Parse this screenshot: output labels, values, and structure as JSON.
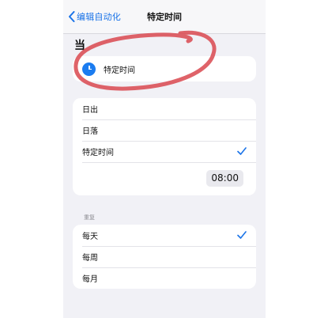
{
  "navbar": {
    "back_label": "编辑自动化",
    "title": "特定时间"
  },
  "trigger": {
    "header": "当",
    "selected_label": "特定时间"
  },
  "options": [
    {
      "label": "日出",
      "checked": false
    },
    {
      "label": "日落",
      "checked": false
    },
    {
      "label": "特定时间",
      "checked": true
    }
  ],
  "time_value": "08:00",
  "repeat": {
    "header": "重复",
    "items": [
      {
        "label": "每天",
        "checked": true
      },
      {
        "label": "每周",
        "checked": false
      },
      {
        "label": "每月",
        "checked": false
      }
    ]
  },
  "colors": {
    "accent": "#1a73e8",
    "annotation_red": "#d9484f"
  },
  "icons": {
    "back": "chevron-left-icon",
    "trigger": "clock-icon",
    "check": "checkmark-icon"
  }
}
